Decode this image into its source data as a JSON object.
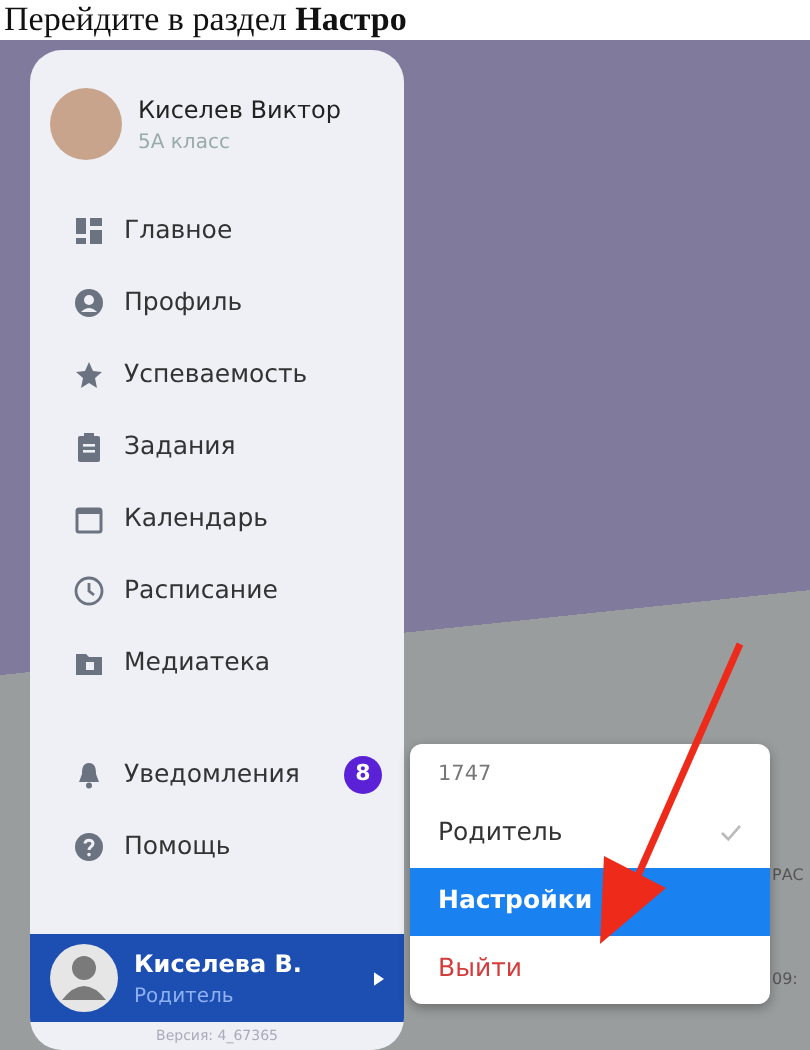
{
  "heading": "Перейдите в раздел **Настро**",
  "user": {
    "name": "Киселев Виктор",
    "class": "5А класс"
  },
  "menu": [
    {
      "label": "Главное",
      "kind": "grid"
    },
    {
      "label": "Профиль",
      "kind": "profile"
    },
    {
      "label": "Успеваемость",
      "kind": "star"
    },
    {
      "label": "Задания",
      "kind": "clipboard"
    },
    {
      "label": "Календарь",
      "kind": "calendar"
    },
    {
      "label": "Расписание",
      "kind": "clock"
    },
    {
      "label": "Медиатека",
      "kind": "folder"
    }
  ],
  "bottom_menu": [
    {
      "label": "Уведомления",
      "kind": "bell",
      "badge": "8"
    },
    {
      "label": "Помощь",
      "kind": "help"
    }
  ],
  "account": {
    "name": "Киселева В.",
    "role": "Родитель",
    "selected": true
  },
  "version": "Версия: 4_67365",
  "popup": {
    "header": "1747",
    "items": [
      {
        "label": "Родитель",
        "kind": "role",
        "checked": true,
        "selected": false
      },
      {
        "label": "Настройки",
        "kind": "action",
        "checked": false,
        "selected": true
      },
      {
        "label": "Выйти",
        "kind": "danger",
        "checked": false,
        "selected": false
      }
    ]
  },
  "background_fragments": [
    "РАС",
    "09:"
  ]
}
